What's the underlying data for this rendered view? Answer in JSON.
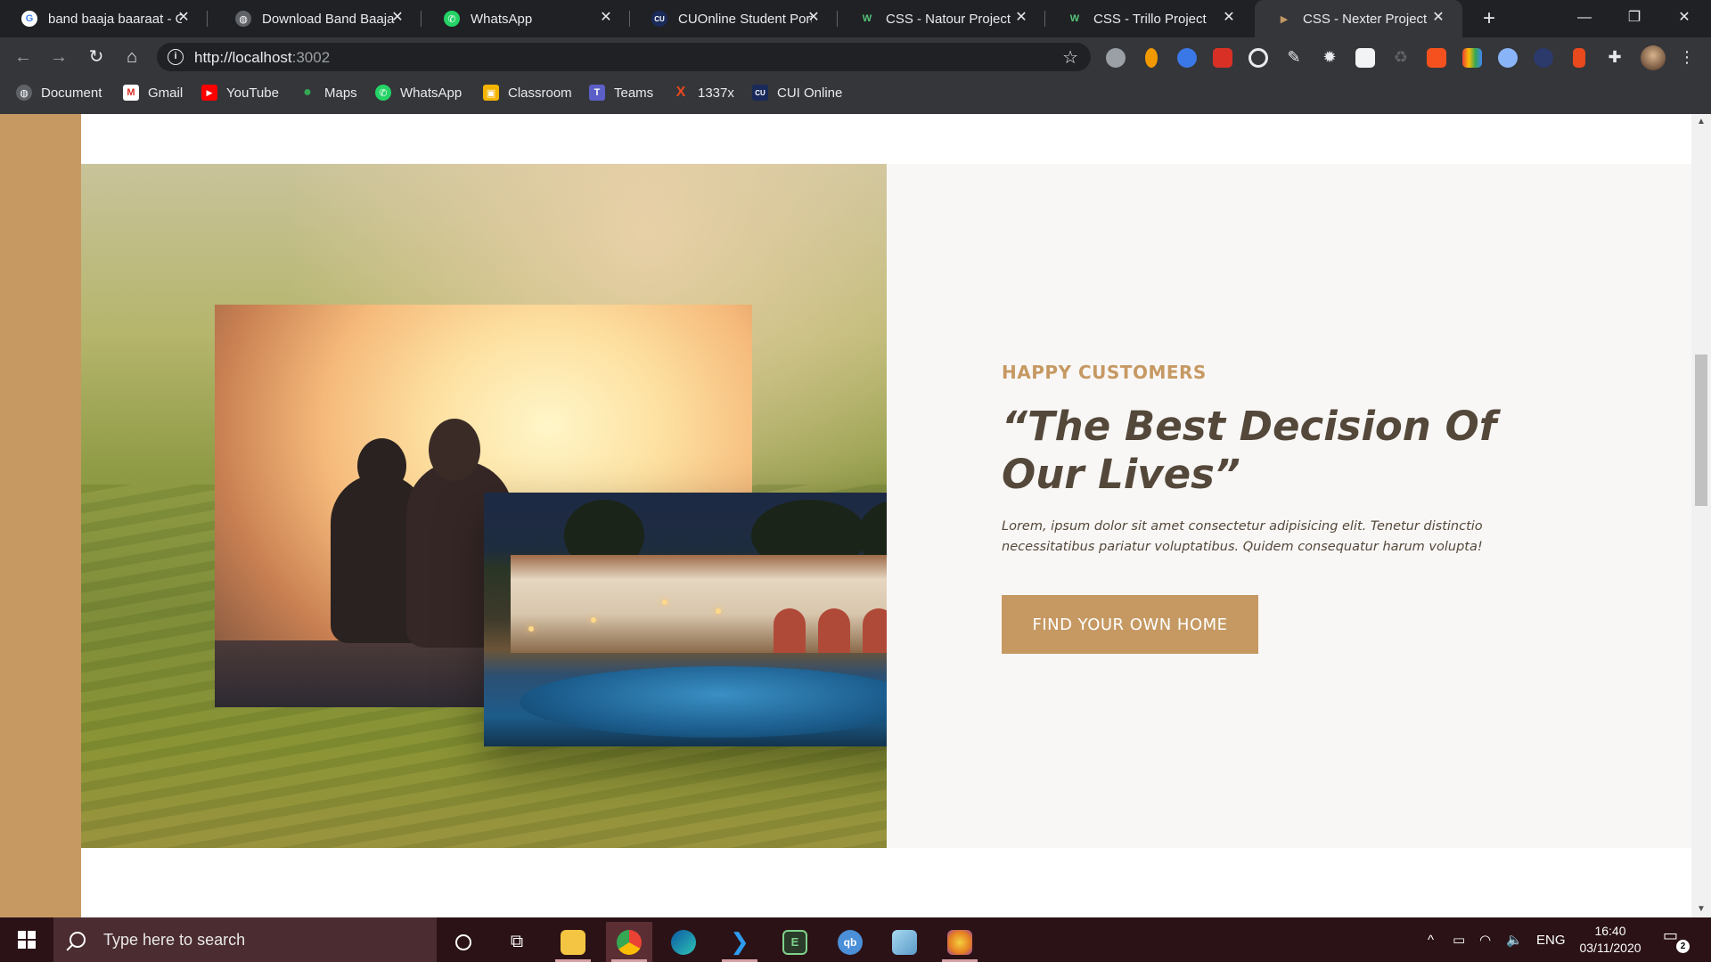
{
  "browser": {
    "tabs": [
      {
        "title": "band baaja baaraat - G",
        "favicon": "google-icon",
        "color": "#4285f4",
        "glyph": "G"
      },
      {
        "title": "Download Band Baaja B",
        "favicon": "globe-icon",
        "color": "#5f6368",
        "glyph": "◍"
      },
      {
        "title": "WhatsApp",
        "favicon": "whatsapp-icon",
        "color": "#25d366",
        "glyph": "✆"
      },
      {
        "title": "CUOnline Student Port",
        "favicon": "cui-icon",
        "color": "#1a2a5a",
        "glyph": "CU"
      },
      {
        "title": "CSS - Natour Project",
        "favicon": "natour-icon",
        "color": "#55c57a",
        "glyph": "W"
      },
      {
        "title": "CSS - Trillo Project",
        "favicon": "trillo-icon",
        "color": "#55c57a",
        "glyph": "W"
      },
      {
        "title": "CSS - Nexter Project",
        "favicon": "nexter-icon",
        "color": "#c69963",
        "glyph": "▶"
      }
    ],
    "active_tab": 6,
    "url_host": "http://localhost",
    "url_port": ":3002",
    "bookmarks": [
      {
        "label": "Document",
        "icon": "globe-icon",
        "color": "#5f6368",
        "glyph": "◍"
      },
      {
        "label": "Gmail",
        "icon": "gmail-icon",
        "color": "#d93025",
        "glyph": "M"
      },
      {
        "label": "YouTube",
        "icon": "youtube-icon",
        "color": "#ff0000",
        "glyph": "▶"
      },
      {
        "label": "Maps",
        "icon": "maps-icon",
        "color": "#34a853",
        "glyph": "●"
      },
      {
        "label": "WhatsApp",
        "icon": "whatsapp-icon",
        "color": "#25d366",
        "glyph": "✆"
      },
      {
        "label": "Classroom",
        "icon": "classroom-icon",
        "color": "#f4b400",
        "glyph": "▣"
      },
      {
        "label": "Teams",
        "icon": "teams-icon",
        "color": "#5b5fc7",
        "glyph": "T"
      },
      {
        "label": "1337x",
        "icon": "1337x-icon",
        "color": "#e8491d",
        "glyph": "X"
      },
      {
        "label": "CUI Online",
        "icon": "cui-icon",
        "color": "#1a2a5a",
        "glyph": "CU"
      }
    ]
  },
  "page": {
    "heading_sub": "HAPPY CUSTOMERS",
    "heading_main": "“The Best Decision Of Our Lives”",
    "story_text": "Lorem, ipsum dolor sit amet consectetur adipisicing elit. Tenetur distinctio necessitatibus pariatur voluptatibus. Quidem consequatur harum volupta!",
    "cta_label": "FIND YOUR OWN HOME",
    "accent_color": "#c69963",
    "text_color": "#54483a"
  },
  "taskbar": {
    "search_placeholder": "Type here to search",
    "language": "ENG",
    "time": "16:40",
    "date": "03/11/2020",
    "notification_count": "2"
  }
}
